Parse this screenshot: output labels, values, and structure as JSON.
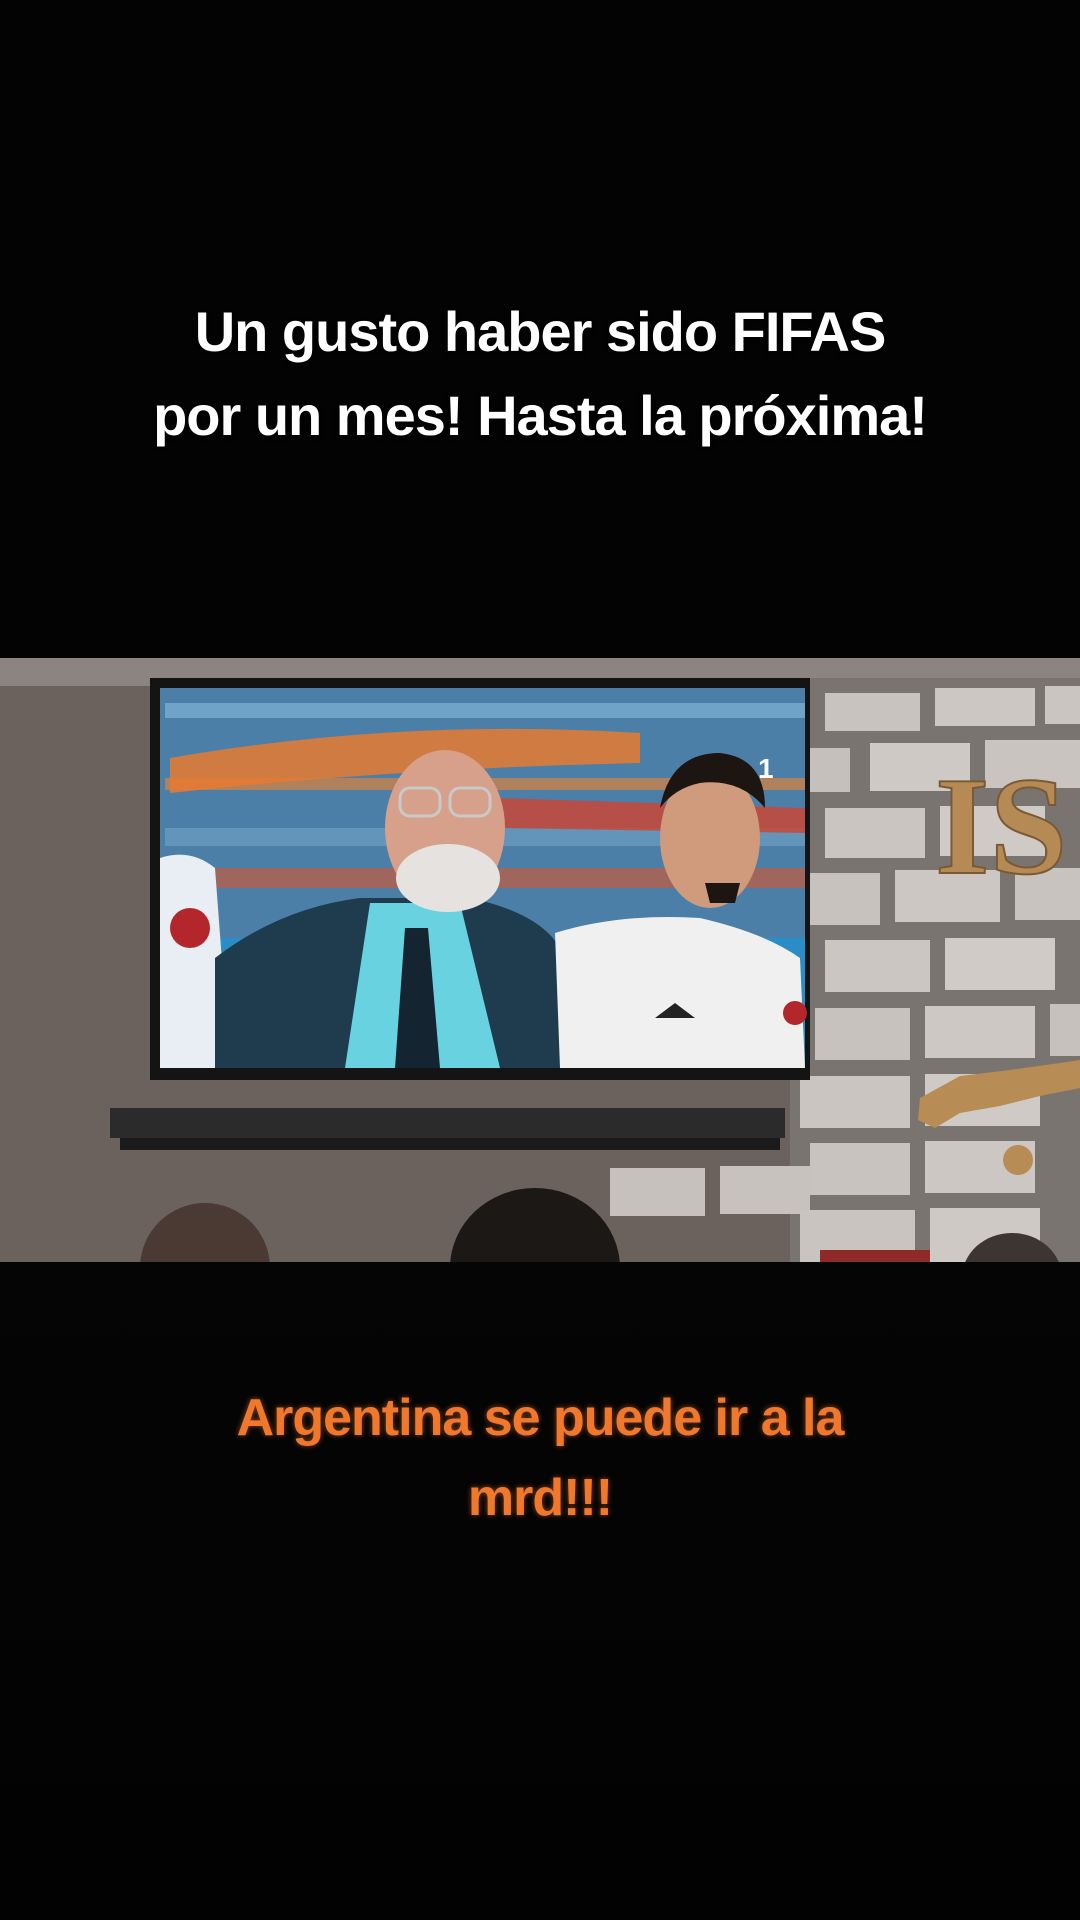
{
  "captions": {
    "top_line1": "Un gusto haber sido FIFAS",
    "top_line2": "por un mes! Hasta la próxima!",
    "bottom_line1": "Argentina se puede ir a la",
    "bottom_line2": "mrd!!!"
  },
  "video": {
    "wall_letters": "IS",
    "scoreboard_digit": "1"
  },
  "colors": {
    "background": "#030303",
    "top_caption": "#ffffff",
    "bottom_caption": "#f0782d"
  }
}
